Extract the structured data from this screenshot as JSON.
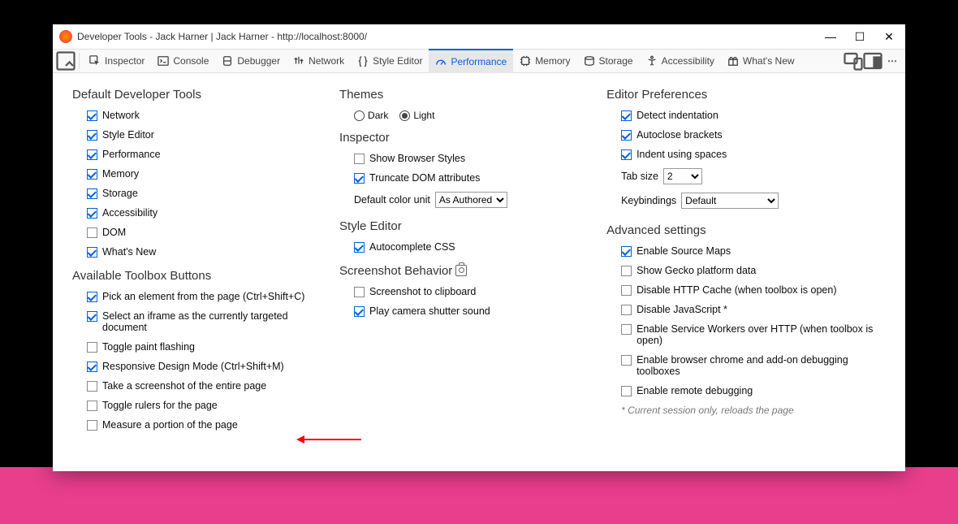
{
  "window_title": "Developer Tools - Jack Harner | Jack Harner - http://localhost:8000/",
  "tabs": {
    "inspector": "Inspector",
    "console": "Console",
    "debugger": "Debugger",
    "network": "Network",
    "style_editor": "Style Editor",
    "performance": "Performance",
    "memory": "Memory",
    "storage": "Storage",
    "accessibility": "Accessibility",
    "whats_new": "What's New"
  },
  "col1": {
    "default_tools_heading": "Default Developer Tools",
    "tools": [
      {
        "label": "Network",
        "checked": true
      },
      {
        "label": "Style Editor",
        "checked": true
      },
      {
        "label": "Performance",
        "checked": true
      },
      {
        "label": "Memory",
        "checked": true
      },
      {
        "label": "Storage",
        "checked": true
      },
      {
        "label": "Accessibility",
        "checked": true
      },
      {
        "label": "DOM",
        "checked": false
      },
      {
        "label": "What's New",
        "checked": true
      }
    ],
    "buttons_heading": "Available Toolbox Buttons",
    "buttons": [
      {
        "label": "Pick an element from the page (Ctrl+Shift+C)",
        "checked": true
      },
      {
        "label": "Select an iframe as the currently targeted document",
        "checked": true
      },
      {
        "label": "Toggle paint flashing",
        "checked": false
      },
      {
        "label": "Responsive Design Mode (Ctrl+Shift+M)",
        "checked": true
      },
      {
        "label": "Take a screenshot of the entire page",
        "checked": false
      },
      {
        "label": "Toggle rulers for the page",
        "checked": false
      },
      {
        "label": "Measure a portion of the page",
        "checked": false
      }
    ]
  },
  "col2": {
    "themes_heading": "Themes",
    "theme_dark": "Dark",
    "theme_light": "Light",
    "theme_selected": "light",
    "inspector_heading": "Inspector",
    "inspector_opts": [
      {
        "label": "Show Browser Styles",
        "checked": false
      },
      {
        "label": "Truncate DOM attributes",
        "checked": true
      }
    ],
    "color_unit_label": "Default color unit",
    "color_unit_value": "As Authored",
    "style_editor_heading": "Style Editor",
    "style_editor_opts": [
      {
        "label": "Autocomplete CSS",
        "checked": true
      }
    ],
    "screenshot_heading": "Screenshot Behavior",
    "screenshot_opts": [
      {
        "label": "Screenshot to clipboard",
        "checked": false
      },
      {
        "label": "Play camera shutter sound",
        "checked": true
      }
    ]
  },
  "col3": {
    "editor_heading": "Editor Preferences",
    "editor_opts": [
      {
        "label": "Detect indentation",
        "checked": true
      },
      {
        "label": "Autoclose brackets",
        "checked": true
      },
      {
        "label": "Indent using spaces",
        "checked": true
      }
    ],
    "tab_size_label": "Tab size",
    "tab_size_value": "2",
    "keybindings_label": "Keybindings",
    "keybindings_value": "Default",
    "advanced_heading": "Advanced settings",
    "advanced_opts": [
      {
        "label": "Enable Source Maps",
        "checked": true
      },
      {
        "label": "Show Gecko platform data",
        "checked": false
      },
      {
        "label": "Disable HTTP Cache (when toolbox is open)",
        "checked": false
      },
      {
        "label": "Disable JavaScript *",
        "checked": false
      },
      {
        "label": "Enable Service Workers over HTTP (when toolbox is open)",
        "checked": false
      },
      {
        "label": "Enable browser chrome and add-on debugging toolboxes",
        "checked": false
      },
      {
        "label": "Enable remote debugging",
        "checked": false
      }
    ],
    "footnote": "* Current session only, reloads the page"
  }
}
